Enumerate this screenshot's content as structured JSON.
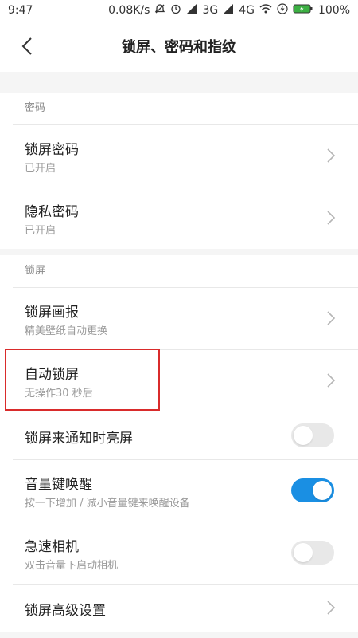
{
  "status_bar": {
    "time": "9:47",
    "speed": "0.08K/s",
    "network_3g": "3G",
    "network_4g": "4G",
    "battery": "100%"
  },
  "header": {
    "title": "锁屏、密码和指纹"
  },
  "sections": {
    "password": {
      "label": "密码",
      "items": [
        {
          "title": "锁屏密码",
          "subtitle": "已开启"
        },
        {
          "title": "隐私密码",
          "subtitle": "已开启"
        }
      ]
    },
    "lockscreen": {
      "label": "锁屏",
      "items": [
        {
          "title": "锁屏画报",
          "subtitle": "精美壁纸自动更换"
        },
        {
          "title": "自动锁屏",
          "subtitle": "无操作30 秒后"
        },
        {
          "title": "锁屏来通知时亮屏",
          "toggle": "off"
        },
        {
          "title": "音量键唤醒",
          "subtitle": "按一下增加 / 减小音量键来唤醒设备",
          "toggle": "on"
        },
        {
          "title": "急速相机",
          "subtitle": "双击音量下启动相机",
          "toggle": "off"
        },
        {
          "title": "锁屏高级设置"
        }
      ]
    }
  },
  "colors": {
    "accent": "#1a8fe3",
    "highlight": "#d92b2b"
  }
}
